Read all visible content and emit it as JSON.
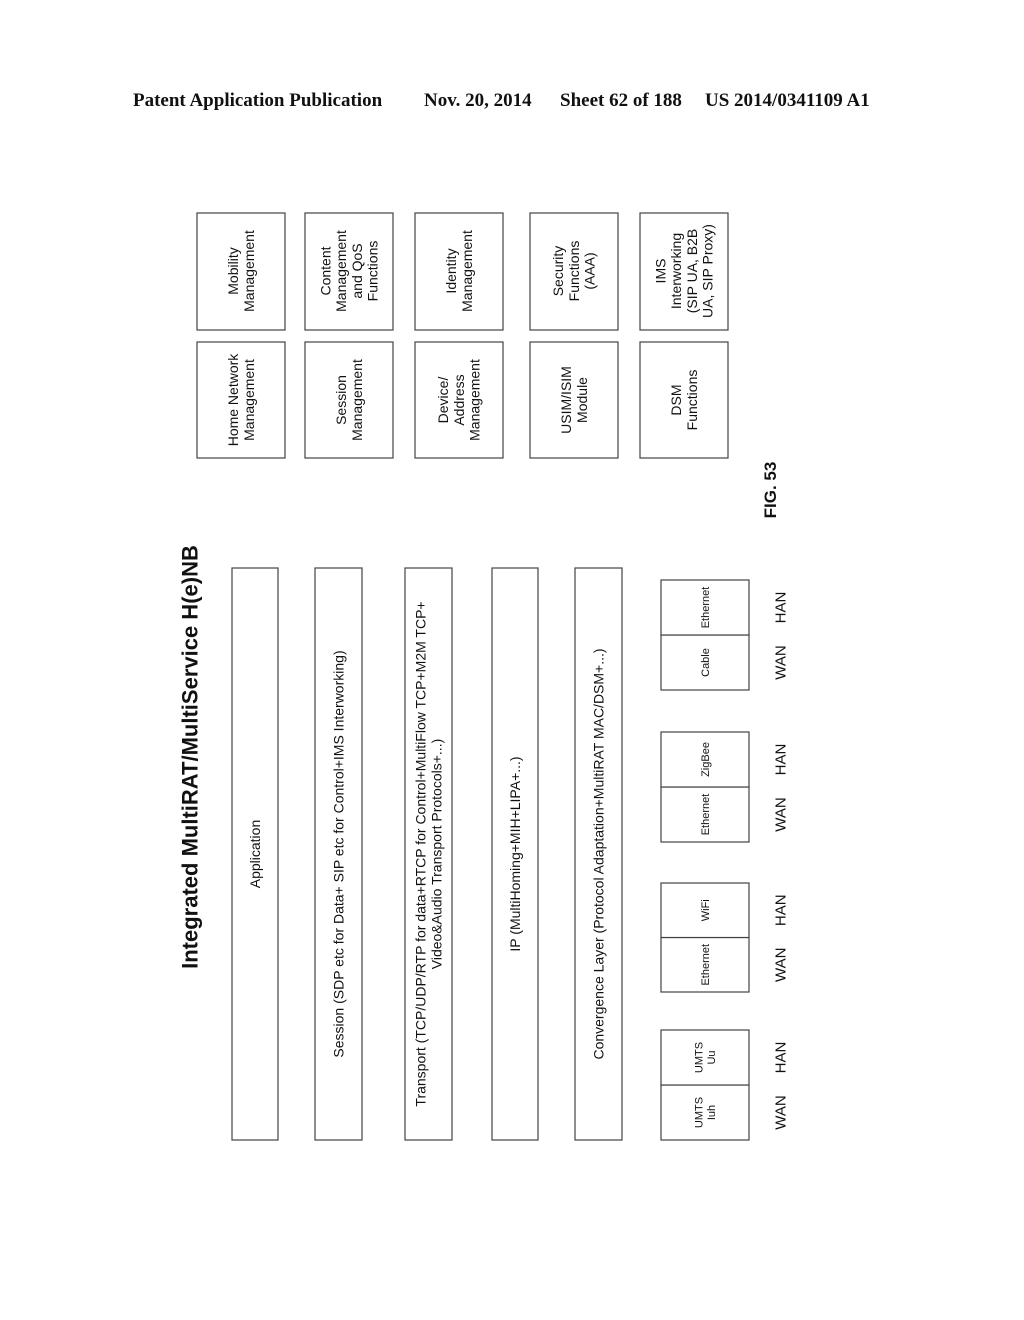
{
  "header": {
    "publication": "Patent Application Publication",
    "date": "Nov. 20, 2014",
    "sheet": "Sheet 62 of 188",
    "number": "US 2014/0341109 A1"
  },
  "figure": {
    "title": "Integrated MultiRAT/MultiService H(e)NB",
    "label": "FIG. 53",
    "layers": [
      {
        "lines": [
          "Application"
        ]
      },
      {
        "lines": [
          "Session (SDP etc for Data+ SIP etc for Control+IMS Interworking)"
        ]
      },
      {
        "lines": [
          "Transport (TCP/UDP/RTP for data+RTCP for Control+MultiFlow TCP+M2M TCP+",
          "Video&Audio Transport Protocols+...)"
        ]
      },
      {
        "lines": [
          "IP (MultiHoming+MIH+LIPA+...)"
        ]
      },
      {
        "lines": [
          "Convergence Layer (Protocol Adaptation+MultiRAT MAC/DSM+...)"
        ]
      }
    ],
    "interfaces": [
      {
        "wan": [
          "UMTS",
          "Iuh"
        ],
        "han": [
          "UMTS",
          "Uu"
        ],
        "wan_label": "WAN",
        "han_label": "HAN"
      },
      {
        "wan": [
          "Ethernet"
        ],
        "han": [
          "WiFi"
        ],
        "wan_label": "WAN",
        "han_label": "HAN"
      },
      {
        "wan": [
          "Ethernet"
        ],
        "han": [
          "ZigBee"
        ],
        "wan_label": "WAN",
        "han_label": "HAN"
      },
      {
        "wan": [
          "Cable"
        ],
        "han": [
          "Ethernet"
        ],
        "wan_label": "WAN",
        "han_label": "HAN"
      }
    ],
    "functions_lower_row": [
      [
        "Home Network",
        "Management"
      ],
      [
        "Session",
        "Management"
      ],
      [
        "Device/",
        "Address",
        "Management"
      ],
      [
        "USIM/ISIM",
        "Module"
      ],
      [
        "DSM",
        "Functions"
      ]
    ],
    "functions_upper_row": [
      [
        "Mobility",
        "Management"
      ],
      [
        "Content",
        "Management",
        "and QoS",
        "Functions"
      ],
      [
        "Identity",
        "Management"
      ],
      [
        "Security",
        "Functions",
        "(AAA)"
      ],
      [
        "IMS",
        "Interworking",
        "(SIP UA, B2B",
        "UA, SIP Proxy)"
      ]
    ]
  }
}
